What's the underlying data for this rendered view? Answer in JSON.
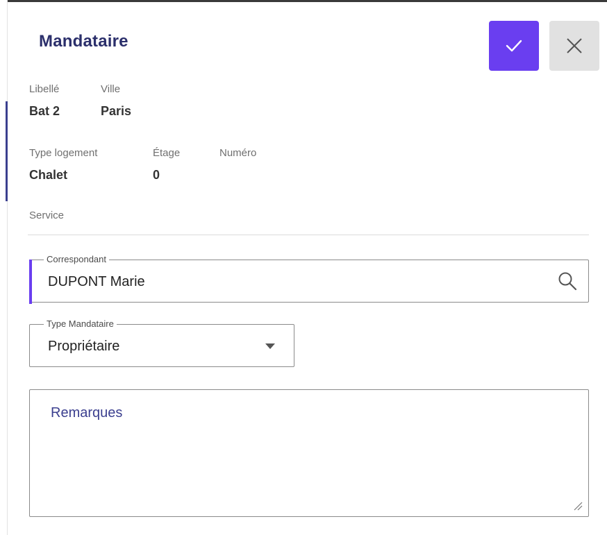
{
  "panel": {
    "title": "Mandataire"
  },
  "actions": {
    "confirm_icon": "check-icon",
    "close_icon": "close-icon",
    "confirm_color": "#6a3ef0",
    "close_color": "#e1e1e1"
  },
  "info": {
    "libelle": {
      "label": "Libellé",
      "value": "Bat 2"
    },
    "ville": {
      "label": "Ville",
      "value": "Paris"
    },
    "type_logement": {
      "label": "Type logement",
      "value": "Chalet"
    },
    "etage": {
      "label": "Étage",
      "value": "0"
    },
    "numero": {
      "label": "Numéro",
      "value": ""
    },
    "service": {
      "label": "Service",
      "value": ""
    }
  },
  "form": {
    "correspondant": {
      "label": "Correspondant",
      "value": "DUPONT Marie",
      "icon": "search-icon"
    },
    "type_mandataire": {
      "label": "Type Mandataire",
      "value": "Propriétaire",
      "icon": "caret-down-icon"
    },
    "remarques": {
      "placeholder": "Remarques",
      "value": ""
    }
  },
  "colors": {
    "accent": "#6a3ef0",
    "title": "#2b2f6b"
  }
}
